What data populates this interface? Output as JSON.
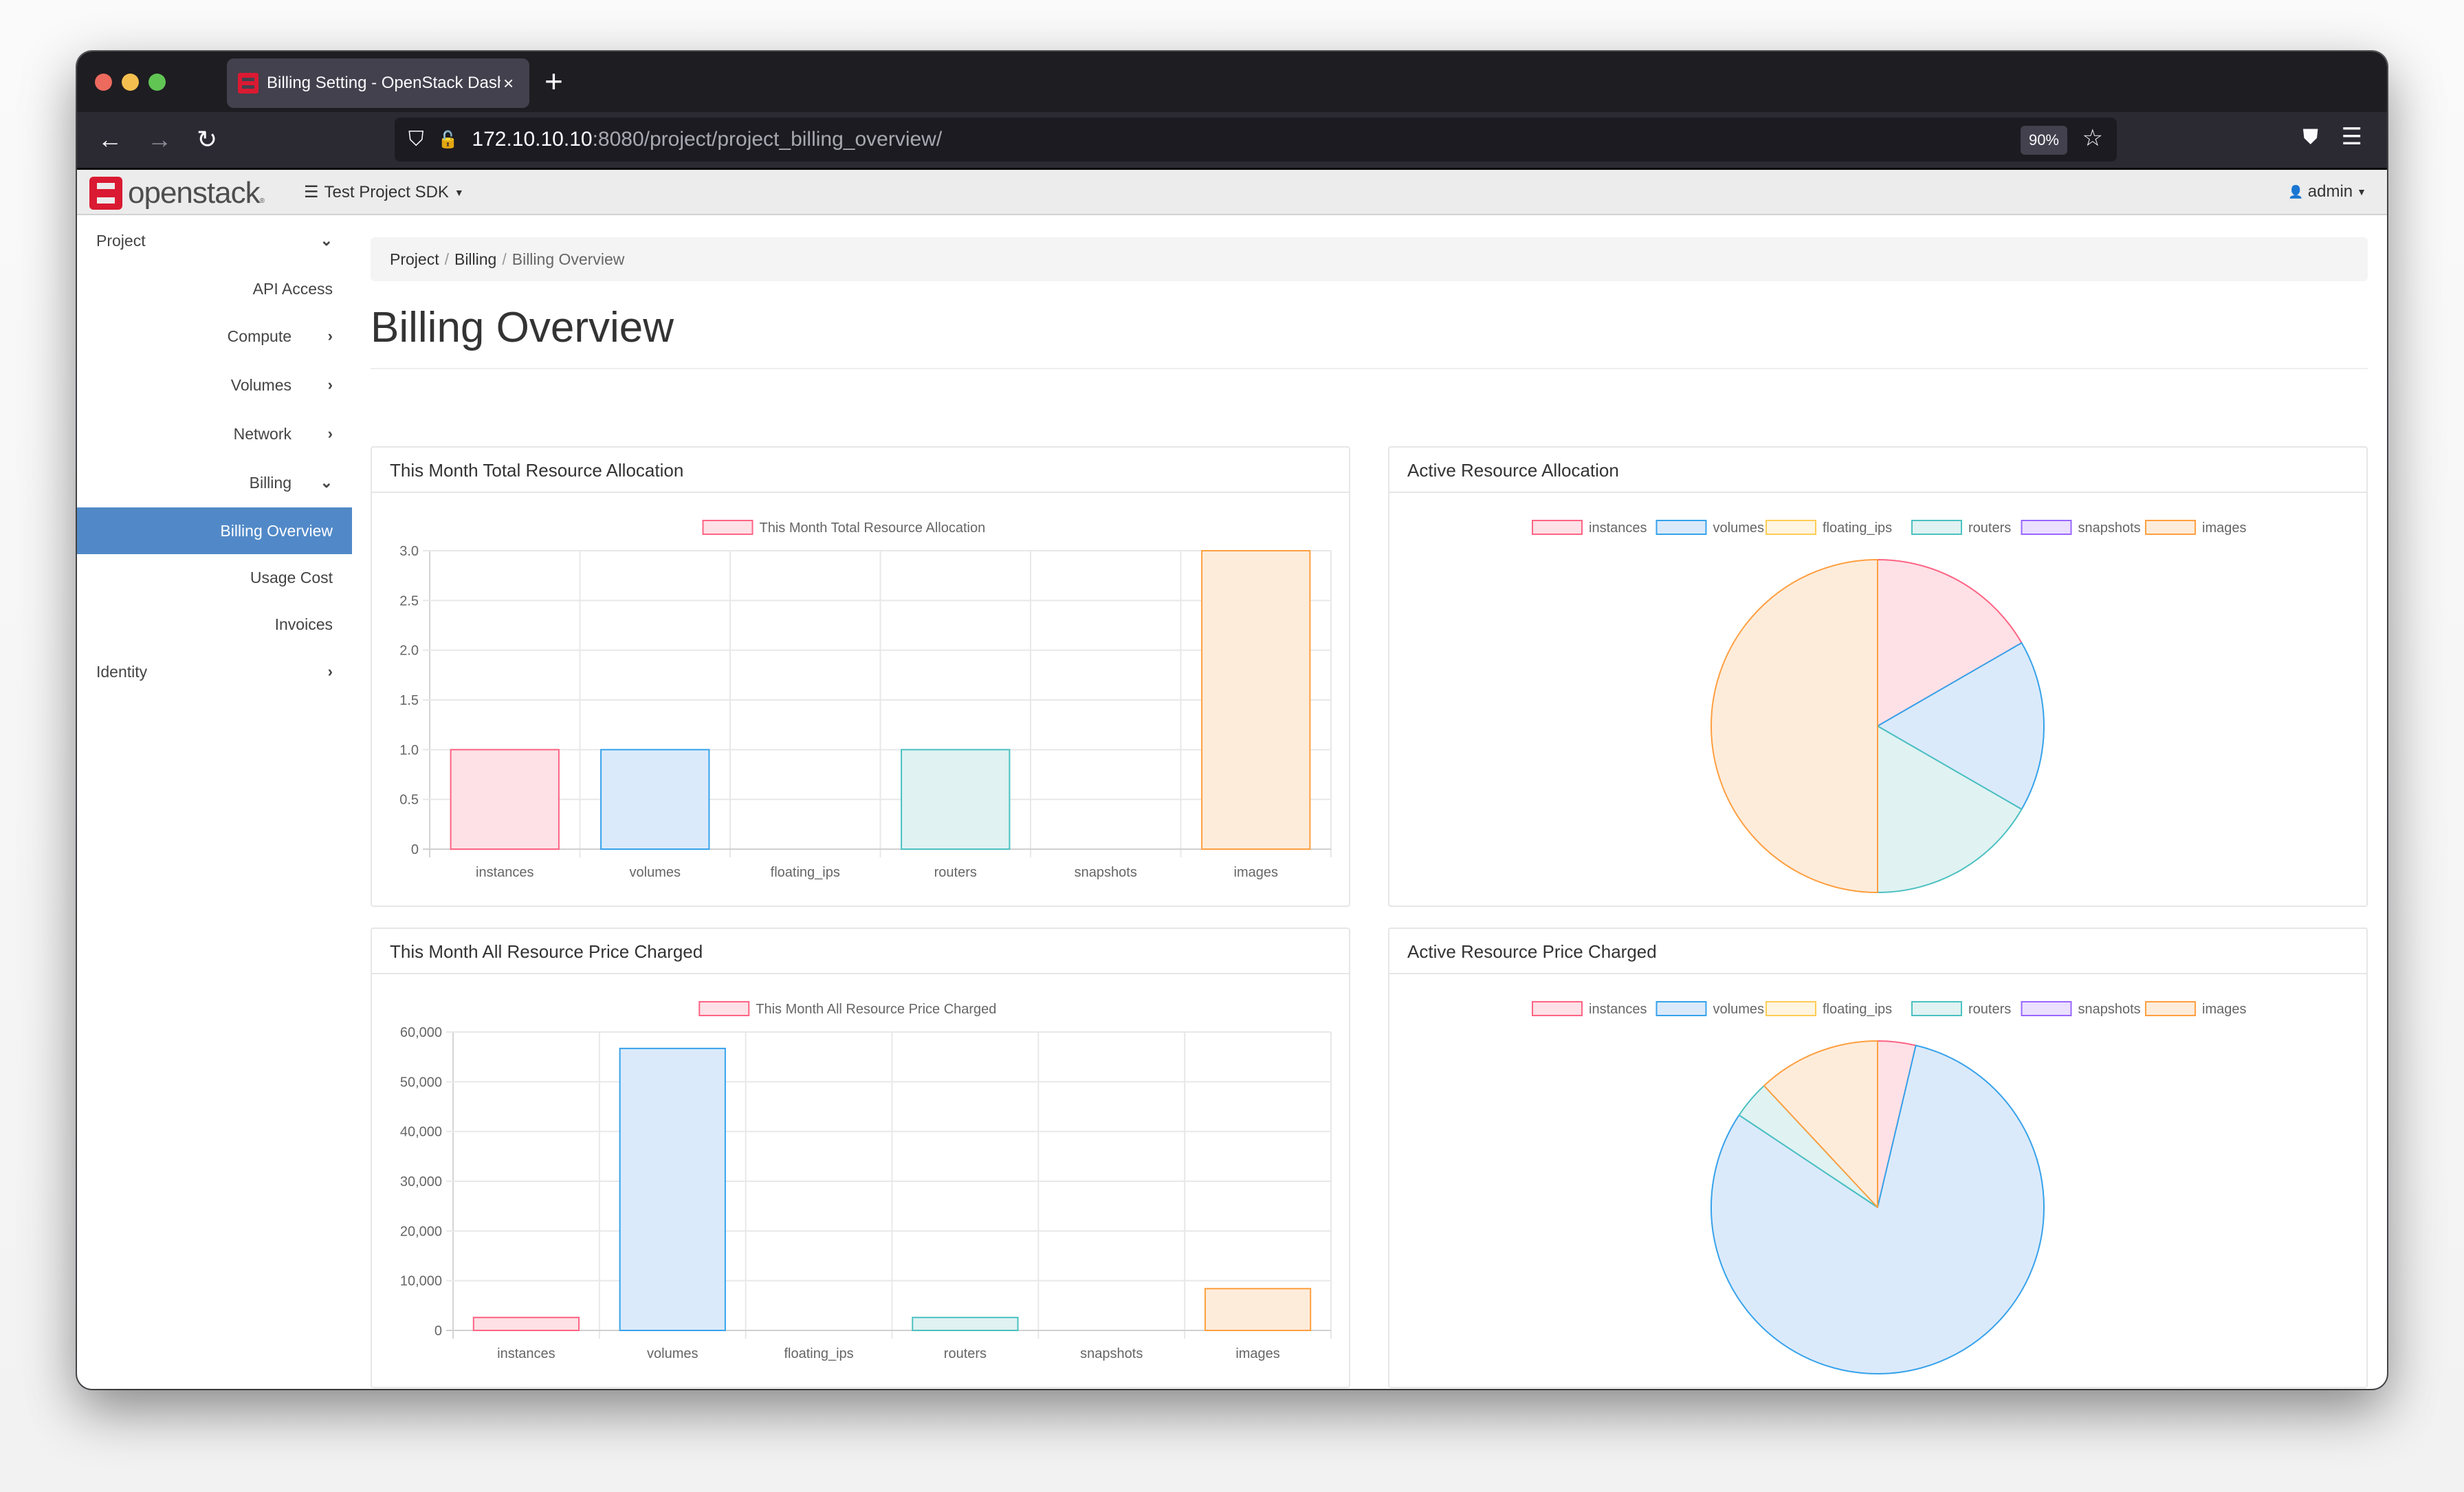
{
  "browser": {
    "tab_title": "Billing Setting - OpenStack Dash",
    "tab_close": "×",
    "new_tab": "+",
    "url_host": "172.10.10.10",
    "url_path": ":8080/project/project_billing_overview/",
    "zoom": "90%",
    "icons": {
      "back": "←",
      "forward": "→",
      "reload": "↻",
      "shield": "⛉",
      "lock": "🔓",
      "star": "☆",
      "pocket": "⛊",
      "menu": "☰"
    }
  },
  "header": {
    "logo_text": "openstack",
    "logo_reg": "®",
    "project_icon": "☰",
    "project_name": "Test Project SDK",
    "caret": "▼",
    "user_icon": "👤",
    "user_name": "admin"
  },
  "sidebar": {
    "items": [
      {
        "label": "Project",
        "chevron": "⌄"
      },
      {
        "label": "API Access"
      },
      {
        "label": "Compute",
        "chevron": "›"
      },
      {
        "label": "Volumes",
        "chevron": "›"
      },
      {
        "label": "Network",
        "chevron": "›"
      },
      {
        "label": "Billing",
        "chevron": "⌄"
      },
      {
        "label": "Billing Overview",
        "active": true
      },
      {
        "label": "Usage Cost"
      },
      {
        "label": "Invoices"
      },
      {
        "label": "Identity",
        "chevron": "›"
      }
    ]
  },
  "breadcrumb": {
    "items": [
      "Project",
      "Billing",
      "Billing Overview"
    ],
    "sep": "/"
  },
  "page_title": "Billing Overview",
  "palette": {
    "instances": {
      "stroke": "#ff6384",
      "fill": "#fde1e6"
    },
    "volumes": {
      "stroke": "#36a2eb",
      "fill": "#dbeafa"
    },
    "floating_ips": {
      "stroke": "#ffcd56",
      "fill": "#fff5e0"
    },
    "routers": {
      "stroke": "#4bc0c0",
      "fill": "#e0f2f2"
    },
    "snapshots": {
      "stroke": "#9966ff",
      "fill": "#ebe0ff"
    },
    "images": {
      "stroke": "#ff9f40",
      "fill": "#feecdb"
    }
  },
  "chart_data": [
    {
      "type": "bar",
      "title": "This Month Total Resource Allocation",
      "legend": [
        "This Month Total Resource Allocation"
      ],
      "legend_position": "top",
      "categories": [
        "instances",
        "volumes",
        "floating_ips",
        "routers",
        "snapshots",
        "images"
      ],
      "values": [
        1,
        1,
        0,
        1,
        0,
        3
      ],
      "ylim": [
        0,
        3
      ],
      "yticks": [
        0,
        0.5,
        1.0,
        1.5,
        2.0,
        2.5,
        3.0
      ],
      "ytick_labels": [
        "0",
        "0.5",
        "1.0",
        "1.5",
        "2.0",
        "2.5",
        "3.0"
      ],
      "xlabel": "",
      "ylabel": "",
      "grid": true
    },
    {
      "type": "pie",
      "title": "Active Resource Allocation",
      "legend": [
        "instances",
        "volumes",
        "floating_ips",
        "routers",
        "snapshots",
        "images"
      ],
      "legend_position": "top",
      "categories": [
        "instances",
        "volumes",
        "floating_ips",
        "routers",
        "snapshots",
        "images"
      ],
      "values": [
        1,
        1,
        0,
        1,
        0,
        3
      ]
    },
    {
      "type": "bar",
      "title": "This Month All Resource Price Charged",
      "legend": [
        "This Month All Resource Price Charged"
      ],
      "legend_position": "top",
      "categories": [
        "instances",
        "volumes",
        "floating_ips",
        "routers",
        "snapshots",
        "images"
      ],
      "values": [
        2600,
        56700,
        0,
        2600,
        0,
        8400
      ],
      "ylim": [
        0,
        60000
      ],
      "yticks": [
        0,
        10000,
        20000,
        30000,
        40000,
        50000,
        60000
      ],
      "ytick_labels": [
        "0",
        "10,000",
        "20,000",
        "30,000",
        "40,000",
        "50,000",
        "60,000"
      ],
      "xlabel": "",
      "ylabel": "",
      "grid": true
    },
    {
      "type": "pie",
      "title": "Active Resource Price Charged",
      "legend": [
        "instances",
        "volumes",
        "floating_ips",
        "routers",
        "snapshots",
        "images"
      ],
      "legend_position": "top",
      "categories": [
        "instances",
        "volumes",
        "floating_ips",
        "routers",
        "snapshots",
        "images"
      ],
      "values": [
        2600,
        56700,
        0,
        2600,
        0,
        8400
      ]
    }
  ]
}
